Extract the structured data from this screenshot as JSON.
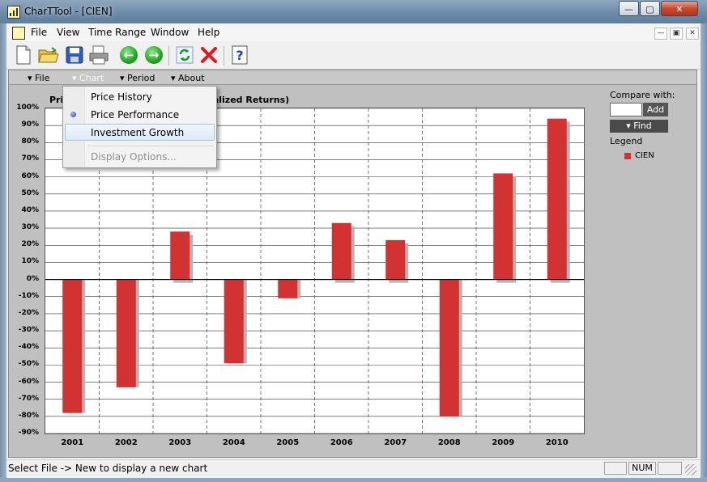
{
  "window": {
    "title": "CharTTool - [CIEN]"
  },
  "menubar": {
    "items": [
      "File",
      "View",
      "Time Range",
      "Window",
      "Help"
    ]
  },
  "panel_menu": {
    "items": [
      "File",
      "Chart",
      "Period",
      "About"
    ]
  },
  "dropdown": {
    "items": [
      {
        "label": "Price History",
        "state": "normal"
      },
      {
        "label": "Price Performance",
        "state": "selected"
      },
      {
        "label": "Investment Growth",
        "state": "hover"
      },
      {
        "label": "Display Options...",
        "state": "disabled"
      }
    ]
  },
  "sidebar": {
    "compare_label": "Compare with:",
    "compare_value": "",
    "add_label": "Add",
    "find_label": "Find",
    "legend_label": "Legend",
    "legend_entry": "CIEN"
  },
  "status": {
    "text": "Select File -> New to display a new chart",
    "num": "NUM"
  },
  "chart_data": {
    "type": "bar",
    "title_prefix": "Pri",
    "title_suffix": "ualized Returns)",
    "categories": [
      "2001",
      "2002",
      "2003",
      "2004",
      "2005",
      "2006",
      "2007",
      "2008",
      "2009",
      "2010"
    ],
    "series": [
      {
        "name": "CIEN",
        "values": [
          -78,
          -63,
          28,
          -49,
          -11,
          33,
          23,
          -80,
          62,
          94
        ],
        "color": "#d23232"
      }
    ],
    "ylim": [
      -90,
      100
    ],
    "yticks": [
      100,
      90,
      80,
      70,
      60,
      50,
      40,
      30,
      20,
      10,
      0,
      -10,
      -20,
      -30,
      -40,
      -50,
      -60,
      -70,
      -80,
      -90
    ],
    "grid": true
  },
  "colors": {
    "bar": "#d23232",
    "shadow": "#b4b4b4"
  }
}
